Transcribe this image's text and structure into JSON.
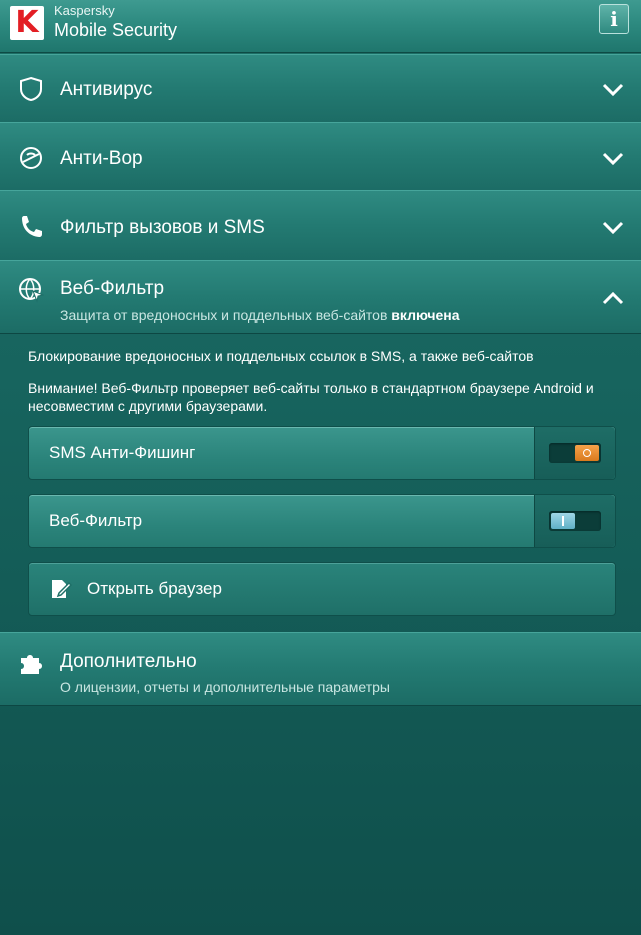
{
  "app": {
    "brand_small": "Kaspersky",
    "brand_big": "Mobile Security",
    "info_label": "i",
    "logo_letter": "K"
  },
  "sections": {
    "antivirus": {
      "title": "Антивирус",
      "icon": "shield-icon",
      "expanded": false
    },
    "antitheft": {
      "title": "Анти-Вор",
      "icon": "anti-theft-icon",
      "expanded": false
    },
    "callfilter": {
      "title": "Фильтр вызовов и SMS",
      "icon": "phone-icon",
      "expanded": false
    },
    "webfilter": {
      "title": "Веб-Фильтр",
      "subtitle_prefix": "Защита от вредоносных и поддельных веб-сайтов",
      "subtitle_status": "включена",
      "icon": "globe-filter-icon",
      "expanded": true,
      "description": "Блокирование вредоносных и поддельных ссылок в SMS, а также веб-сайтов",
      "warning": "Внимание! Веб-Фильтр проверяет веб-сайты только в стандартном браузере Android и несовместим с другими браузерами.",
      "toggles": [
        {
          "label": "SMS Анти-Фишинг",
          "state": "on"
        },
        {
          "label": "Веб-Фильтр",
          "state": "off"
        }
      ],
      "open_browser_label": "Открыть браузер"
    },
    "additional": {
      "title": "Дополнительно",
      "subtitle": "О лицензии, отчеты и дополнительные параметры",
      "icon": "puzzle-icon"
    }
  },
  "colors": {
    "accent": "#e31e24",
    "toggle_on": "#e88b2e",
    "toggle_off": "#7fc4d8",
    "background": "#17645e"
  }
}
